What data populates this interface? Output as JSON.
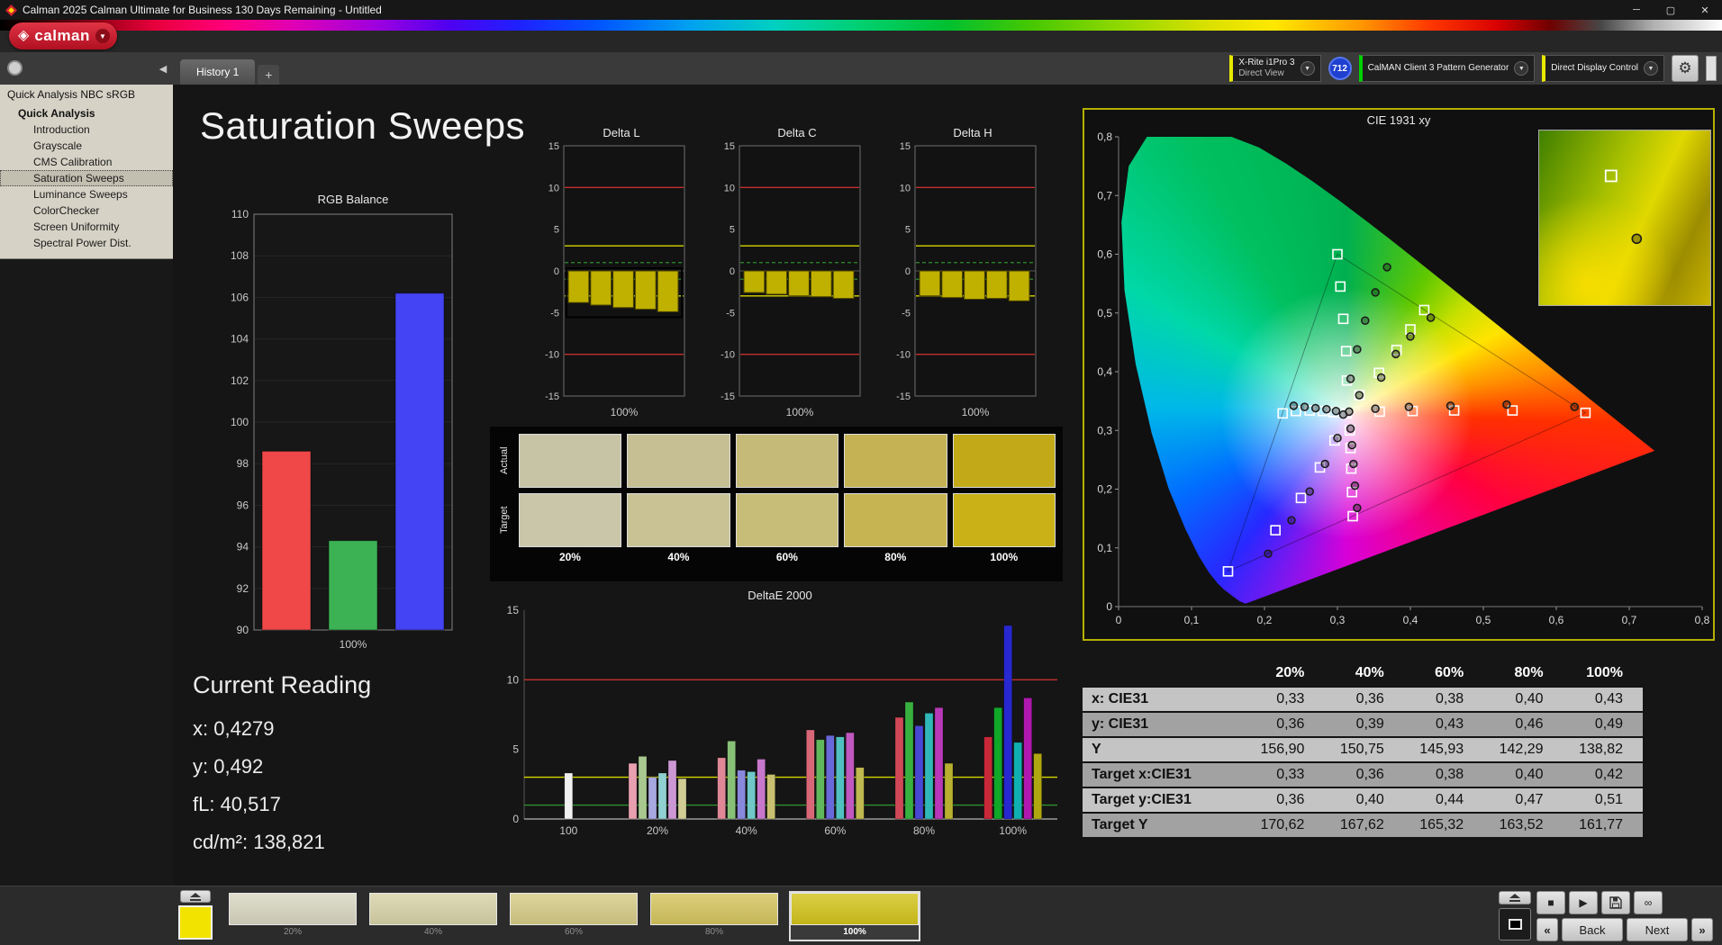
{
  "titlebar": {
    "title": "Calman 2025 Calman Ultimate for Business 130 Days Remaining  - Untitled"
  },
  "icons": {
    "minimize": "─",
    "maximize": "▢",
    "close": "✕",
    "caret_down": "▼",
    "collapse_left": "◀",
    "gear": "⚙",
    "add_tab": "+",
    "play": "▶",
    "stop": "■",
    "infinity": "∞",
    "back_chevrons": "«",
    "next_chevrons": "»"
  },
  "toolbar": {
    "logo_text": "calman",
    "meter": {
      "line1": "X-Rite i1Pro 3",
      "line2": "Direct View"
    },
    "meter_badge": "712",
    "pattern_generator": "CalMAN Client 3 Pattern Generator",
    "display_control": "Direct Display Control"
  },
  "tabs": {
    "active_tab": "History 1"
  },
  "sidebar": {
    "header": "Quick Analysis NBC sRGB",
    "tree_root": "Quick Analysis",
    "items": [
      {
        "label": "Introduction",
        "selected": false
      },
      {
        "label": "Grayscale",
        "selected": false
      },
      {
        "label": "CMS Calibration",
        "selected": false
      },
      {
        "label": "Saturation Sweeps",
        "selected": true
      },
      {
        "label": "Luminance Sweeps",
        "selected": false
      },
      {
        "label": "ColorChecker",
        "selected": false
      },
      {
        "label": "Screen Uniformity",
        "selected": false
      },
      {
        "label": "Spectral Power Dist.",
        "selected": false
      }
    ]
  },
  "main": {
    "page_title": "Saturation Sweeps",
    "current_reading": {
      "heading": "Current Reading",
      "lines": [
        "x: 0,4279",
        "y: 0,492",
        "fL: 40,517",
        "cd/m²: 138,821"
      ]
    }
  },
  "swatch_panel": {
    "rows": [
      {
        "label": "Actual",
        "colors": [
          "#c7c4a6",
          "#c6bf93",
          "#c5ba78",
          "#c4b254",
          "#c2a918"
        ]
      },
      {
        "label": "Target",
        "colors": [
          "#c9c6aa",
          "#c8c295",
          "#c7bd78",
          "#c6b452",
          "#c9b117"
        ]
      }
    ],
    "percent_labels": [
      "20%",
      "40%",
      "60%",
      "80%",
      "100%"
    ]
  },
  "bottombar": {
    "current_swatch_color": "#f2e300",
    "patches": [
      {
        "label": "20%",
        "color": "#d9d7c2",
        "selected": false
      },
      {
        "label": "40%",
        "color": "#d8d3a8",
        "selected": false
      },
      {
        "label": "60%",
        "color": "#d6cc86",
        "selected": false
      },
      {
        "label": "80%",
        "color": "#d5c55e",
        "selected": false
      },
      {
        "label": "100%",
        "color": "#d4c41c",
        "selected": true
      }
    ],
    "back_label": "Back",
    "next_label": "Next"
  },
  "chart_data": [
    {
      "id": "rgb_balance",
      "type": "bar",
      "title": "RGB Balance",
      "categories": [
        "Red",
        "Green",
        "Blue"
      ],
      "values": [
        98.6,
        94.3,
        106.2
      ],
      "colors": [
        "#f04848",
        "#3cb254",
        "#4444f4"
      ],
      "ylim": [
        90,
        110
      ],
      "yticks": [
        110,
        108,
        106,
        104,
        102,
        100,
        98,
        96,
        94,
        92,
        90
      ],
      "xlabel": "100%",
      "grid": true,
      "legend": false
    },
    {
      "id": "delta_l",
      "type": "bar",
      "title": "Delta L",
      "categories": [
        "20%",
        "40%",
        "60%",
        "80%",
        "100%"
      ],
      "values": [
        -3.8,
        -4.1,
        -4.4,
        -4.6,
        -4.9
      ],
      "bar_color": "#c0b000",
      "selected": true,
      "ylim": [
        -15,
        15
      ],
      "yticks": [
        15,
        10,
        5,
        0,
        -5,
        -10,
        -15
      ],
      "ref_lines": [
        {
          "y": 10,
          "color": "#c23030"
        },
        {
          "y": -10,
          "color": "#c23030"
        },
        {
          "y": 3,
          "color": "#d6d600"
        },
        {
          "y": -3,
          "color": "#d6d600"
        },
        {
          "y": 1,
          "color": "#2f8f2f",
          "dash": true
        },
        {
          "y": -1,
          "color": "#2f8f2f",
          "dash": true
        }
      ],
      "xlabel": "100%"
    },
    {
      "id": "delta_c",
      "type": "bar",
      "title": "Delta C",
      "categories": [
        "20%",
        "40%",
        "60%",
        "80%",
        "100%"
      ],
      "values": [
        -2.6,
        -2.8,
        -3.0,
        -3.1,
        -3.3
      ],
      "bar_color": "#c0b000",
      "selected": false,
      "ylim": [
        -15,
        15
      ],
      "yticks": [
        15,
        10,
        5,
        0,
        -5,
        -10,
        -15
      ],
      "ref_lines": [
        {
          "y": 10,
          "color": "#c23030"
        },
        {
          "y": -10,
          "color": "#c23030"
        },
        {
          "y": 3,
          "color": "#d6d600"
        },
        {
          "y": -3,
          "color": "#d6d600"
        },
        {
          "y": 1,
          "color": "#2f8f2f",
          "dash": true
        },
        {
          "y": -1,
          "color": "#2f8f2f",
          "dash": true
        }
      ],
      "xlabel": "100%"
    },
    {
      "id": "delta_h",
      "type": "bar",
      "title": "Delta H",
      "categories": [
        "20%",
        "40%",
        "60%",
        "80%",
        "100%"
      ],
      "values": [
        -3.0,
        -3.2,
        -3.4,
        -3.3,
        -3.6
      ],
      "bar_color": "#c0b000",
      "selected": false,
      "ylim": [
        -15,
        15
      ],
      "yticks": [
        15,
        10,
        5,
        0,
        -5,
        -10,
        -15
      ],
      "ref_lines": [
        {
          "y": 10,
          "color": "#c23030"
        },
        {
          "y": -10,
          "color": "#c23030"
        },
        {
          "y": 3,
          "color": "#d6d600"
        },
        {
          "y": -3,
          "color": "#d6d600"
        },
        {
          "y": 1,
          "color": "#2f8f2f",
          "dash": true
        },
        {
          "y": -1,
          "color": "#2f8f2f",
          "dash": true
        }
      ],
      "xlabel": "100%"
    },
    {
      "id": "deltae2000",
      "type": "bar",
      "title": "DeltaE 2000",
      "ylim": [
        0,
        15
      ],
      "yticks": [
        15,
        10,
        5,
        0
      ],
      "ref_lines": [
        {
          "y": 10,
          "color": "#c23030"
        },
        {
          "y": 3,
          "color": "#d6d600"
        },
        {
          "y": 1,
          "color": "#2f8f2f"
        }
      ],
      "groups": [
        {
          "label": "100",
          "bars": [
            {
              "value": 3.3,
              "color": "#f0f0f0"
            }
          ]
        },
        {
          "label": "20%",
          "bars": [
            {
              "value": 4.0,
              "color": "#e8a0b0"
            },
            {
              "value": 4.5,
              "color": "#a8c890"
            },
            {
              "value": 3.0,
              "color": "#a8a8e0"
            },
            {
              "value": 3.3,
              "color": "#90d0d0"
            },
            {
              "value": 4.2,
              "color": "#cc98d4"
            },
            {
              "value": 2.9,
              "color": "#d0cc94"
            }
          ]
        },
        {
          "label": "40%",
          "bars": [
            {
              "value": 4.4,
              "color": "#e08898"
            },
            {
              "value": 5.6,
              "color": "#88c078"
            },
            {
              "value": 3.5,
              "color": "#8888dc"
            },
            {
              "value": 3.4,
              "color": "#70c8c8"
            },
            {
              "value": 4.3,
              "color": "#c878cc"
            },
            {
              "value": 3.2,
              "color": "#c8c070"
            }
          ]
        },
        {
          "label": "60%",
          "bars": [
            {
              "value": 6.4,
              "color": "#d86878"
            },
            {
              "value": 5.7,
              "color": "#60b85c"
            },
            {
              "value": 6.0,
              "color": "#6868d8"
            },
            {
              "value": 5.9,
              "color": "#50c0c0"
            },
            {
              "value": 6.2,
              "color": "#c058c0"
            },
            {
              "value": 3.7,
              "color": "#c0b850"
            }
          ]
        },
        {
          "label": "80%",
          "bars": [
            {
              "value": 7.3,
              "color": "#d04858"
            },
            {
              "value": 8.4,
              "color": "#38b040"
            },
            {
              "value": 6.7,
              "color": "#4848d4"
            },
            {
              "value": 7.6,
              "color": "#30b8b8"
            },
            {
              "value": 8.0,
              "color": "#b838b8"
            },
            {
              "value": 4.0,
              "color": "#b8b030"
            }
          ]
        },
        {
          "label": "100%",
          "bars": [
            {
              "value": 5.9,
              "color": "#c82838"
            },
            {
              "value": 8.0,
              "color": "#10a828"
            },
            {
              "value": 13.9,
              "color": "#2828d0"
            },
            {
              "value": 5.5,
              "color": "#10b0b0"
            },
            {
              "value": 8.7,
              "color": "#b018b0"
            },
            {
              "value": 4.7,
              "color": "#b0a810"
            }
          ]
        }
      ]
    },
    {
      "id": "cie1931",
      "type": "scatter",
      "title": "CIE 1931 xy",
      "xlim": [
        0,
        0.8
      ],
      "ylim": [
        0,
        0.8
      ],
      "xtick_vals": [
        0,
        0.1,
        0.2,
        0.3,
        0.4,
        0.5,
        0.6,
        0.7,
        0.8
      ],
      "xticks": [
        "0",
        "0,1",
        "0,2",
        "0,3",
        "0,4",
        "0,5",
        "0,6",
        "0,7",
        "0,8"
      ],
      "ytick_vals": [
        0,
        0.1,
        0.2,
        0.3,
        0.4,
        0.5,
        0.6,
        0.7,
        0.8
      ],
      "yticks": [
        "0",
        "0,1",
        "0,2",
        "0,3",
        "0,4",
        "0,5",
        "0,6",
        "0,7",
        "0,8"
      ],
      "gamut_triangle": [
        [
          0.64,
          0.33
        ],
        [
          0.3,
          0.6
        ],
        [
          0.15,
          0.06
        ]
      ],
      "target_points": [
        [
          0.313,
          0.329
        ],
        [
          0.358,
          0.332
        ],
        [
          0.403,
          0.333
        ],
        [
          0.46,
          0.334
        ],
        [
          0.54,
          0.334
        ],
        [
          0.64,
          0.33
        ],
        [
          0.313,
          0.385
        ],
        [
          0.312,
          0.435
        ],
        [
          0.308,
          0.49
        ],
        [
          0.304,
          0.545
        ],
        [
          0.3,
          0.6
        ],
        [
          0.296,
          0.283
        ],
        [
          0.276,
          0.237
        ],
        [
          0.25,
          0.185
        ],
        [
          0.215,
          0.13
        ],
        [
          0.15,
          0.06
        ],
        [
          0.295,
          0.331
        ],
        [
          0.28,
          0.333
        ],
        [
          0.262,
          0.334
        ],
        [
          0.243,
          0.333
        ],
        [
          0.225,
          0.329
        ],
        [
          0.317,
          0.3
        ],
        [
          0.318,
          0.27
        ],
        [
          0.319,
          0.235
        ],
        [
          0.32,
          0.195
        ],
        [
          0.321,
          0.154
        ],
        [
          0.33,
          0.36
        ],
        [
          0.357,
          0.398
        ],
        [
          0.381,
          0.437
        ],
        [
          0.4,
          0.472
        ],
        [
          0.419,
          0.505
        ]
      ],
      "measured_points": [
        [
          0.308,
          0.327
        ],
        [
          0.316,
          0.332
        ],
        [
          0.352,
          0.337
        ],
        [
          0.398,
          0.34
        ],
        [
          0.455,
          0.342
        ],
        [
          0.532,
          0.344
        ],
        [
          0.625,
          0.34
        ],
        [
          0.318,
          0.388
        ],
        [
          0.327,
          0.438
        ],
        [
          0.338,
          0.487
        ],
        [
          0.352,
          0.535
        ],
        [
          0.368,
          0.578
        ],
        [
          0.3,
          0.287
        ],
        [
          0.283,
          0.243
        ],
        [
          0.262,
          0.196
        ],
        [
          0.237,
          0.147
        ],
        [
          0.205,
          0.09
        ],
        [
          0.298,
          0.333
        ],
        [
          0.285,
          0.336
        ],
        [
          0.27,
          0.338
        ],
        [
          0.255,
          0.34
        ],
        [
          0.24,
          0.342
        ],
        [
          0.318,
          0.303
        ],
        [
          0.32,
          0.275
        ],
        [
          0.322,
          0.243
        ],
        [
          0.324,
          0.206
        ],
        [
          0.327,
          0.168
        ],
        [
          0.33,
          0.36
        ],
        [
          0.36,
          0.39
        ],
        [
          0.38,
          0.43
        ],
        [
          0.4,
          0.46
        ],
        [
          0.4279,
          0.492
        ]
      ],
      "inset": {
        "square_pos": [
          0.42,
          0.26
        ],
        "circle_pos": [
          0.57,
          0.62
        ]
      }
    },
    {
      "id": "data_table",
      "type": "table",
      "columns": [
        "",
        "20%",
        "40%",
        "60%",
        "80%",
        "100%"
      ],
      "rows": [
        {
          "label": "x: CIE31",
          "values": [
            "0,33",
            "0,36",
            "0,38",
            "0,40",
            "0,43"
          ]
        },
        {
          "label": "y: CIE31",
          "values": [
            "0,36",
            "0,39",
            "0,43",
            "0,46",
            "0,49"
          ]
        },
        {
          "label": "Y",
          "values": [
            "156,90",
            "150,75",
            "145,93",
            "142,29",
            "138,82"
          ]
        },
        {
          "label": "Target x:CIE31",
          "values": [
            "0,33",
            "0,36",
            "0,38",
            "0,40",
            "0,42"
          ]
        },
        {
          "label": "Target y:CIE31",
          "values": [
            "0,36",
            "0,40",
            "0,44",
            "0,47",
            "0,51"
          ]
        },
        {
          "label": "Target Y",
          "values": [
            "170,62",
            "167,62",
            "165,32",
            "163,52",
            "161,77"
          ]
        }
      ]
    }
  ]
}
